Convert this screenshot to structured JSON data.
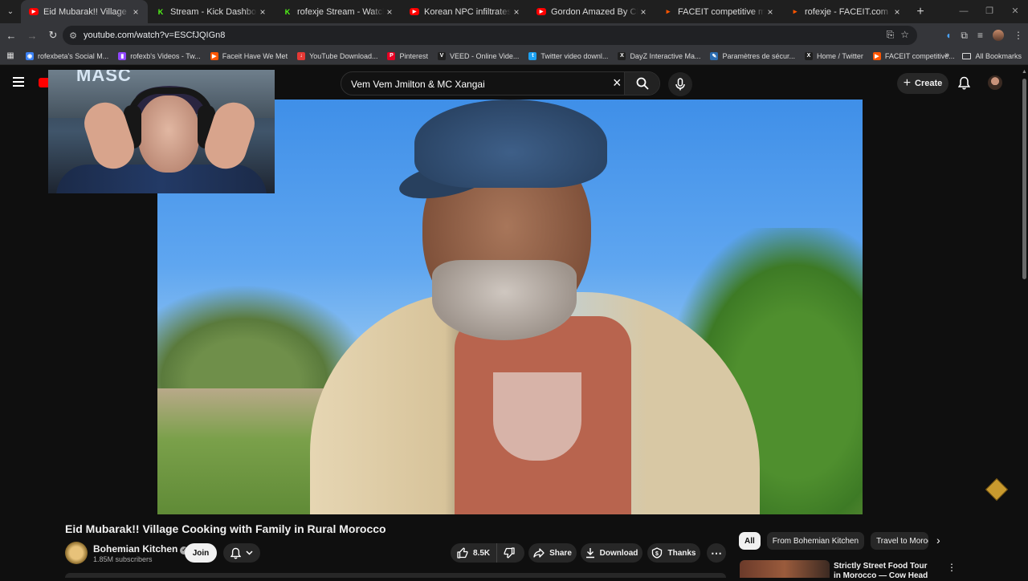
{
  "browser": {
    "tabs": [
      {
        "title": "Eid Mubarak!! Village Cooking",
        "favicon": "youtube-icon",
        "color": "#ff0000",
        "active": true
      },
      {
        "title": "Stream - Kick Dashboard",
        "favicon": "kick-icon",
        "color": "#53fc18",
        "active": false
      },
      {
        "title": "rofexje Stream - Watch Live on",
        "favicon": "kick-icon",
        "color": "#53fc18",
        "active": false
      },
      {
        "title": "Korean NPC infiltrates Sony HQ",
        "favicon": "youtube-icon",
        "color": "#ff0000",
        "active": false
      },
      {
        "title": "Gordon Amazed By Chef Who",
        "favicon": "youtube-icon",
        "color": "#ff0000",
        "active": false
      },
      {
        "title": "FACEIT competitive match - FA",
        "favicon": "faceit-icon",
        "color": "#ff5500",
        "active": false
      },
      {
        "title": "rofexje - FACEIT.com",
        "favicon": "faceit-icon",
        "color": "#ff5500",
        "active": false
      }
    ],
    "url": "youtube.com/watch?v=ESCfJQIGn8",
    "bookmarks": [
      {
        "label": "rofexbeta's Social M...",
        "color": "#3b82f6",
        "glyph": "◉"
      },
      {
        "label": "rofexb's Videos - Tw...",
        "color": "#9146ff",
        "glyph": "▮"
      },
      {
        "label": "Faceit Have We Met",
        "color": "#ff5500",
        "glyph": "▶"
      },
      {
        "label": "YouTube Download...",
        "color": "#e53935",
        "glyph": "↓"
      },
      {
        "label": "Pinterest",
        "color": "#e60023",
        "glyph": "P"
      },
      {
        "label": "VEED - Online Vide...",
        "color": "#1f1f1f",
        "glyph": "V"
      },
      {
        "label": "Twitter video downl...",
        "color": "#1da1f2",
        "glyph": "t"
      },
      {
        "label": "DayZ Interactive Ma...",
        "color": "#1f1f1f",
        "glyph": "X"
      },
      {
        "label": "Paramètres de sécur...",
        "color": "#2b6cb0",
        "glyph": "✎"
      },
      {
        "label": "Home / Twitter",
        "color": "#1f1f1f",
        "glyph": "X"
      },
      {
        "label": "FACEIT competitive...",
        "color": "#ff5500",
        "glyph": "▶"
      }
    ],
    "all_bookmarks": "All Bookmarks"
  },
  "youtube": {
    "search_query": "Vem Vem Jmilton & MC Xangai",
    "create_label": "Create",
    "webcam_brand": "MASC",
    "video": {
      "title": "Eid Mubarak!! Village Cooking with Family in Rural Morocco",
      "channel": "Bohemian Kitchen",
      "subscribers": "1.85M subscribers",
      "join_label": "Join",
      "likes": "8.5K",
      "share_label": "Share",
      "download_label": "Download",
      "thanks_label": "Thanks"
    },
    "chips": [
      "All",
      "From Bohemian Kitchen",
      "Travel to Morocco"
    ],
    "recommendation": {
      "title": "Strictly Street Food Tour in Morocco — Cow Head"
    }
  }
}
